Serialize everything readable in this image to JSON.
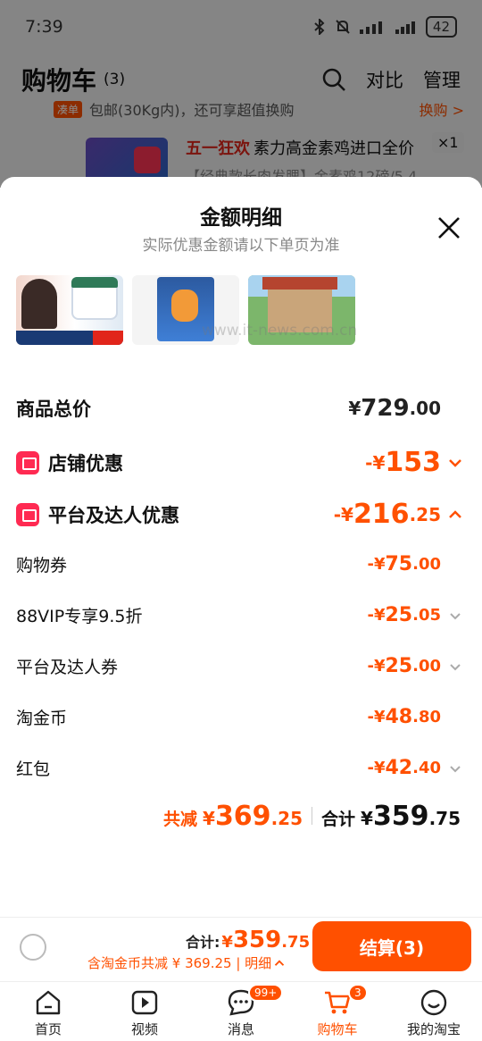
{
  "status_bar": {
    "time": "7:39",
    "battery": "42"
  },
  "header": {
    "title": "购物车",
    "count": "(3)",
    "compare": "对比",
    "manage": "管理"
  },
  "background": {
    "strip_tag": "凑单",
    "strip_text": "包邮(30Kg内)，还可享超值换购",
    "strip_action": "换购 >",
    "product_promo": "五一狂欢",
    "product_title": "素力高金素鸡进口全价",
    "product_subtitle": "【经典款长肉发腮】金素鸡12磅/5.4",
    "product_qty": "×1"
  },
  "sheet": {
    "title": "金额明细",
    "subtitle": "实际优惠金额请以下单页为准",
    "watermark": "www.it-news.com.cn"
  },
  "rows": {
    "total": {
      "label": "商品总价",
      "cur": "¥",
      "int": "729",
      "dec": ".00"
    },
    "store": {
      "label": "店铺优惠",
      "cur": "-¥",
      "int": "153",
      "dec": ""
    },
    "platform": {
      "label": "平台及达人优惠",
      "cur": "-¥",
      "int": "216",
      "dec": ".25"
    },
    "items": [
      {
        "label": "购物券",
        "cur": "-¥",
        "int": "75",
        "dec": ".00"
      },
      {
        "label": "88VIP专享9.5折",
        "cur": "-¥",
        "int": "25",
        "dec": ".05"
      },
      {
        "label": "平台及达人券",
        "cur": "-¥",
        "int": "25",
        "dec": ".00"
      },
      {
        "label": "淘金币",
        "cur": "-¥",
        "int": "48",
        "dec": ".80"
      },
      {
        "label": "红包",
        "cur": "-¥",
        "int": "42",
        "dec": ".40"
      }
    ]
  },
  "summary": {
    "saved_label": "共减",
    "saved_cur": "¥",
    "saved_int": "369",
    "saved_dec": ".25",
    "total_label": "合计",
    "total_cur": "¥",
    "total_int": "359",
    "total_dec": ".75"
  },
  "bottom": {
    "total_label": "合计:",
    "total_cur": "¥",
    "total_int": "359",
    "total_dec": ".75",
    "sub_text": "含淘金币共减 ¥ 369.25 | 明细",
    "checkout": "结算(3)"
  },
  "tabs": [
    {
      "label": "首页"
    },
    {
      "label": "视频"
    },
    {
      "label": "消息",
      "badge": "99+"
    },
    {
      "label": "购物车",
      "badge": "3"
    },
    {
      "label": "我的淘宝"
    }
  ],
  "colors": {
    "accent": "#ff5000",
    "red": "#ff2a52"
  }
}
